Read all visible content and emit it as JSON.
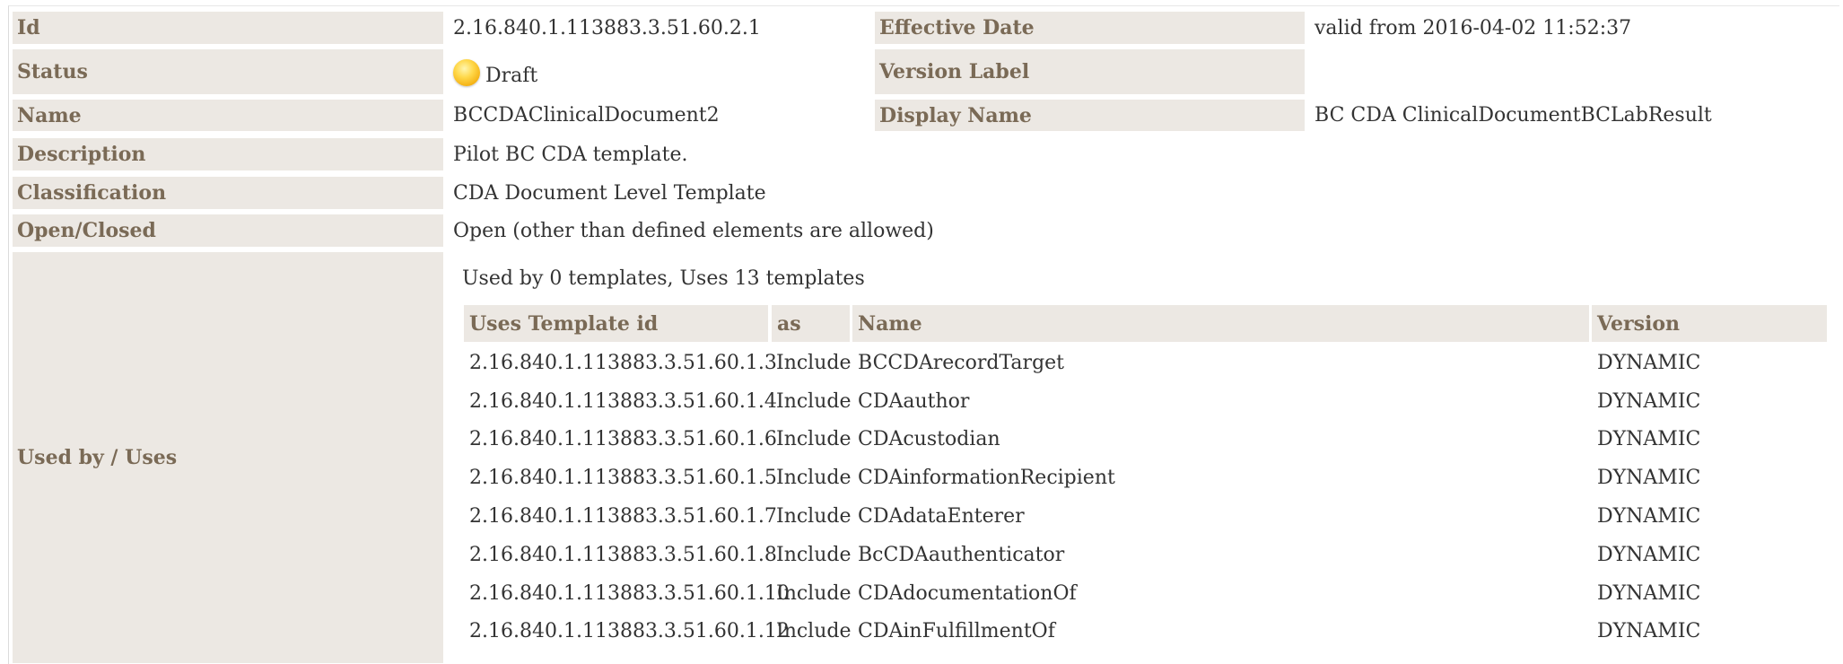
{
  "fields": {
    "id_label": "Id",
    "id_value": "2.16.840.1.113883.3.51.60.2.1",
    "effective_label": "Effective Date",
    "effective_value": "valid from 2016-04-02 11:52:37",
    "status_label": "Status",
    "status_value": "Draft",
    "version_label_label": "Version Label",
    "version_label_value": "",
    "name_label": "Name",
    "name_value": "BCCDAClinicalDocument2",
    "display_name_label": "Display Name",
    "display_name_value": "BC CDA ClinicalDocumentBCLabResult",
    "description_label": "Description",
    "description_value": "Pilot BC CDA template.",
    "classification_label": "Classification",
    "classification_value": "CDA Document Level Template",
    "open_closed_label": "Open/Closed",
    "open_closed_value": "Open (other than defined elements are allowed)",
    "used_by_label": "Used by / Uses",
    "used_by_summary": "Used by 0 templates, Uses 13 templates"
  },
  "status_color": "#f5b800",
  "status_icon": "yellow-status-dot-icon",
  "uses_table": {
    "headers": [
      "Uses Template id",
      "as",
      "Name",
      "Version"
    ],
    "rows": [
      [
        "2.16.840.1.113883.3.51.60.1.3",
        "Include",
        "BCCDArecordTarget",
        "DYNAMIC"
      ],
      [
        "2.16.840.1.113883.3.51.60.1.4",
        "Include",
        "CDAauthor",
        "DYNAMIC"
      ],
      [
        "2.16.840.1.113883.3.51.60.1.6",
        "Include",
        "CDAcustodian",
        "DYNAMIC"
      ],
      [
        "2.16.840.1.113883.3.51.60.1.5",
        "Include",
        "CDAinformationRecipient",
        "DYNAMIC"
      ],
      [
        "2.16.840.1.113883.3.51.60.1.7",
        "Include",
        "CDAdataEnterer",
        "DYNAMIC"
      ],
      [
        "2.16.840.1.113883.3.51.60.1.8",
        "Include",
        "BcCDAauthenticator",
        "DYNAMIC"
      ],
      [
        "2.16.840.1.113883.3.51.60.1.10",
        "Include",
        "CDAdocumentationOf",
        "DYNAMIC"
      ],
      [
        "2.16.840.1.113883.3.51.60.1.12",
        "Include",
        "CDAinFulfillmentOf",
        "DYNAMIC"
      ]
    ]
  }
}
